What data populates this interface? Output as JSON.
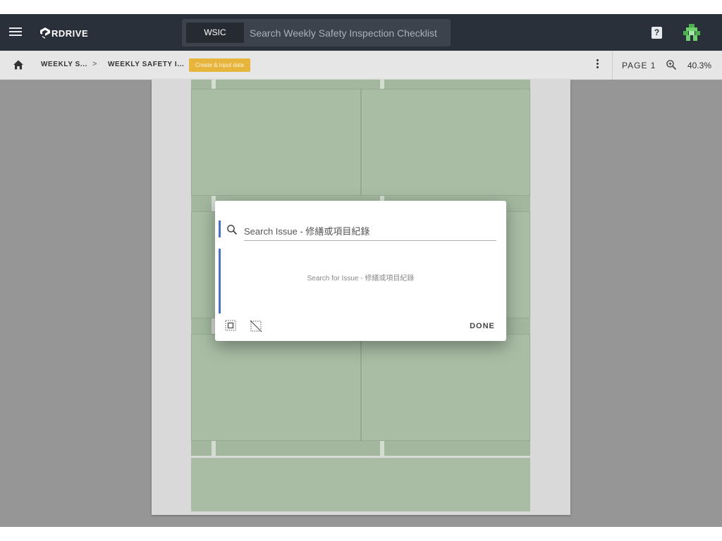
{
  "header": {
    "logo_text": "RDRIVE",
    "search": {
      "scope": "WSIC",
      "placeholder": "Search Weekly Safety Inspection Checklist"
    },
    "help_label": "?"
  },
  "toolbar": {
    "breadcrumbs": [
      "WEEKLY S...",
      "WEEKLY SAFETY I..."
    ],
    "separator": ">",
    "badge": "Create & input data",
    "page_label": "PAGE 1",
    "zoom_value": "40.3%"
  },
  "dialog": {
    "search_placeholder": "Search Issue - 修繕或項目紀錄",
    "empty_text": "Search for Issue - 修繕或項目紀錄",
    "done_label": "DONE"
  },
  "colors": {
    "header_bg": "#2a3039",
    "badge_bg": "#e7b43c",
    "accent": "#4472c4",
    "form_green": "#a9bda5"
  },
  "icons": [
    "menu-icon",
    "rdrive-logo-icon",
    "help-icon",
    "avatar-icon",
    "home-icon",
    "more-vert-icon",
    "zoom-icon",
    "search-icon",
    "select-all-icon",
    "deselect-icon"
  ]
}
